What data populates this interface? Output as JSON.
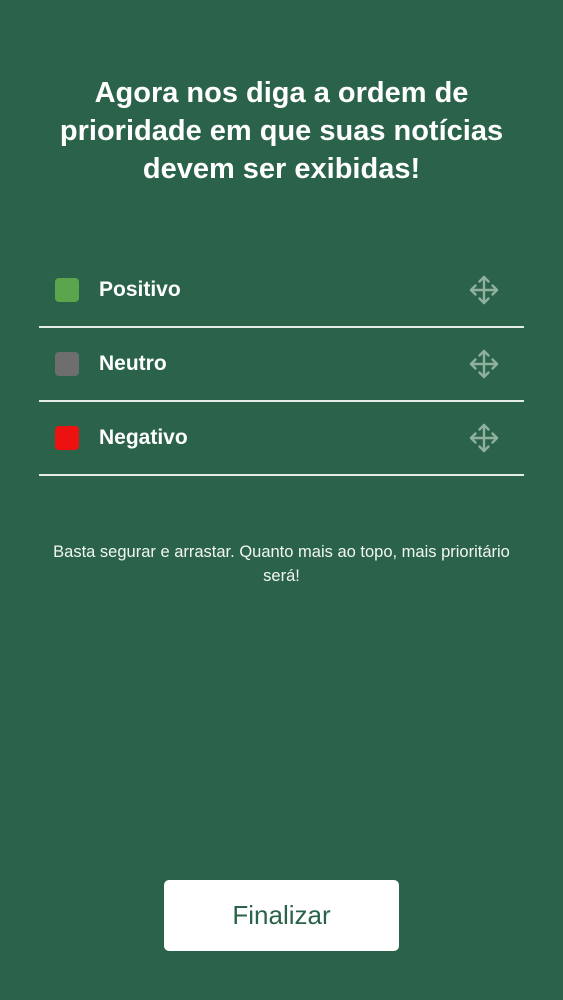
{
  "header": {
    "title": "Agora nos diga a ordem de prioridade em que suas notícias devem ser exibidas!"
  },
  "priority_list": {
    "items": [
      {
        "label": "Positivo",
        "color": "#5ba64d",
        "icon": "drag-handle-icon"
      },
      {
        "label": "Neutro",
        "color": "#6e6e6e",
        "icon": "drag-handle-icon"
      },
      {
        "label": "Negativo",
        "color": "#ee1111",
        "icon": "drag-handle-icon"
      }
    ]
  },
  "hint": "Basta segurar e arrastar. Quanto mais ao topo, mais prioritário será!",
  "footer": {
    "finish_label": "Finalizar"
  },
  "colors": {
    "background": "#2a6349",
    "button_bg": "#ffffff",
    "button_text": "#2a6349",
    "divider": "#e4ece7",
    "handle": "#8fb09f"
  }
}
